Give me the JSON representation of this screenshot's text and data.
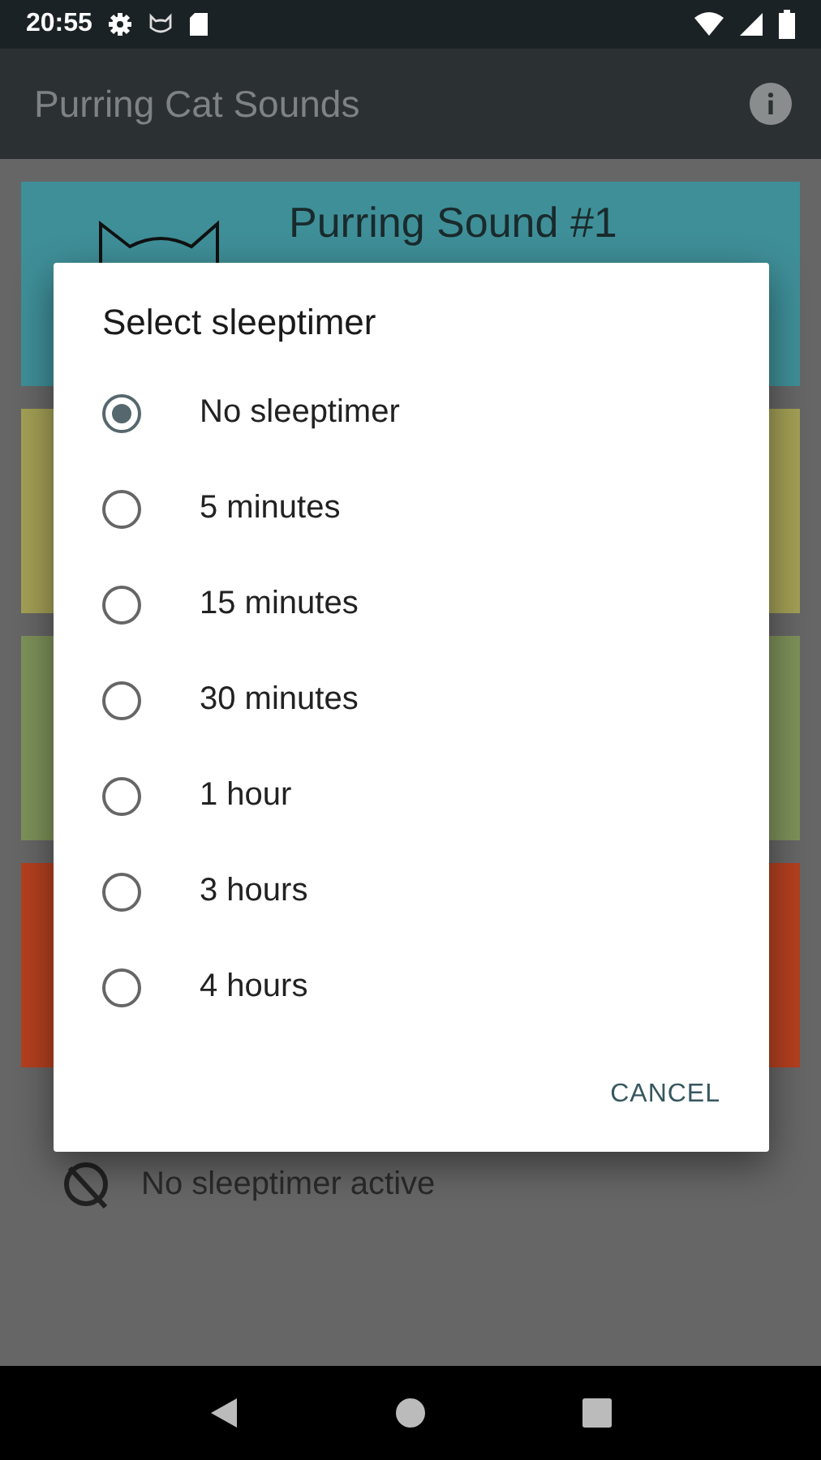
{
  "status_bar": {
    "time": "20:55"
  },
  "app_bar": {
    "title": "Purring Cat Sounds"
  },
  "cards": [
    {
      "title": "Purring Sound #1",
      "color": "#3f8f98"
    },
    {
      "color": "#a39f55"
    },
    {
      "color": "#7d9159"
    },
    {
      "color": "#b4401f"
    }
  ],
  "sleeptimer_status": "No sleeptimer active",
  "dialog": {
    "title": "Select sleeptimer",
    "options": [
      {
        "label": "No sleeptimer",
        "selected": true
      },
      {
        "label": "5 minutes",
        "selected": false
      },
      {
        "label": "15 minutes",
        "selected": false
      },
      {
        "label": "30 minutes",
        "selected": false
      },
      {
        "label": "1 hour",
        "selected": false
      },
      {
        "label": "3 hours",
        "selected": false
      },
      {
        "label": "4 hours",
        "selected": false
      }
    ],
    "buttons": [
      "CANCEL"
    ]
  }
}
